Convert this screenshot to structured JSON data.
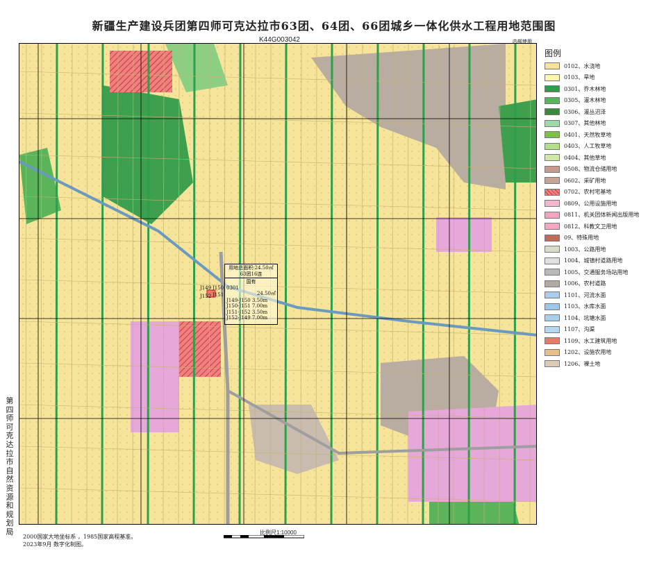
{
  "title": "新疆生产建设兵团第四师可克达拉市63团、64团、66团城乡一体化供水工程用地范围图",
  "sheet_number": "K44G003042",
  "internal_use": "内部使用",
  "legend": {
    "heading": "图例",
    "items": [
      {
        "code": "0102",
        "label": "0102、水浇地",
        "color": "#f5e49a",
        "pattern": ""
      },
      {
        "code": "0103",
        "label": "0103、旱地",
        "color": "#fff6b0",
        "pattern": ""
      },
      {
        "code": "0301",
        "label": "0301、乔木林地",
        "color": "#2e9e4a",
        "pattern": ""
      },
      {
        "code": "0305",
        "label": "0305、灌木林地",
        "color": "#5bb45a",
        "pattern": ""
      },
      {
        "code": "0306",
        "label": "0306、灌丛沼泽",
        "color": "#3a8a3e",
        "pattern": ""
      },
      {
        "code": "0307",
        "label": "0307、其他林地",
        "color": "#9fd9a8",
        "pattern": ""
      },
      {
        "code": "0401",
        "label": "0401、天然牧草地",
        "color": "#7cc24a",
        "pattern": ""
      },
      {
        "code": "0403",
        "label": "0403、人工牧草地",
        "color": "#b5de88",
        "pattern": ""
      },
      {
        "code": "0404",
        "label": "0404、其他草地",
        "color": "#cfe8a6",
        "pattern": ""
      },
      {
        "code": "0508",
        "label": "0508、物流仓储用地",
        "color": "#c69a8e",
        "pattern": ""
      },
      {
        "code": "0602",
        "label": "0602、采矿用地",
        "color": "#c4a497",
        "pattern": ""
      },
      {
        "code": "0702",
        "label": "0702、农村宅基地",
        "color": "#f08080",
        "pattern": "hatch"
      },
      {
        "code": "0809",
        "label": "0809、公用设施用地",
        "color": "#f3b6cf",
        "pattern": ""
      },
      {
        "code": "0811",
        "label": "0811、机关团体新闻出版用地",
        "color": "#f2a5c0",
        "pattern": ""
      },
      {
        "code": "0812",
        "label": "0812、科教文卫用地",
        "color": "#f2a8c2",
        "pattern": ""
      },
      {
        "code": "09",
        "label": "09、特殊用地",
        "color": "#c06a5a",
        "pattern": ""
      },
      {
        "code": "1003",
        "label": "1003、公路用地",
        "color": "#d8dcc8",
        "pattern": ""
      },
      {
        "code": "1004",
        "label": "1004、城镇村道路用地",
        "color": "#e0e0e0",
        "pattern": ""
      },
      {
        "code": "1005",
        "label": "1005、交通服务场站用地",
        "color": "#b9b9b9",
        "pattern": ""
      },
      {
        "code": "1006",
        "label": "1006、农村道路",
        "color": "#b0aaa0",
        "pattern": ""
      },
      {
        "code": "1101",
        "label": "1101、河流水面",
        "color": "#a9cdea",
        "pattern": ""
      },
      {
        "code": "1103",
        "label": "1103、水库水面",
        "color": "#9ec8e8",
        "pattern": ""
      },
      {
        "code": "1104",
        "label": "1104、坑塘水面",
        "color": "#a8d0ec",
        "pattern": ""
      },
      {
        "code": "1107",
        "label": "1107、沟渠",
        "color": "#b4d8f0",
        "pattern": ""
      },
      {
        "code": "1109",
        "label": "1109、水工建筑用地",
        "color": "#e87b68",
        "pattern": ""
      },
      {
        "code": "1202",
        "label": "1202、设施农用地",
        "color": "#e6c08a",
        "pattern": ""
      },
      {
        "code": "1206",
        "label": "1206、裸土地",
        "color": "#dccab8",
        "pattern": ""
      }
    ]
  },
  "info_box": {
    "lines": [
      "用地总面积:24.50㎡",
      "63团16连",
      "国有",
      "0301",
      "24.50㎡",
      "J149-J150  3.50m",
      "J150-J151  7.00m",
      "J151-J152  3.50m",
      "J152-J149  7.00m"
    ]
  },
  "point_labels": {
    "p149": "J149",
    "p150": "J150",
    "p151": "J151",
    "p152": "J152"
  },
  "publisher": "第四师可克达拉市自然资源和规划局",
  "notes": [
    "2000国家大地坐标系 ，1985国家高程基准。",
    "2023年9月 数字化制图。"
  ],
  "scale_text": "比例尺1:10000"
}
